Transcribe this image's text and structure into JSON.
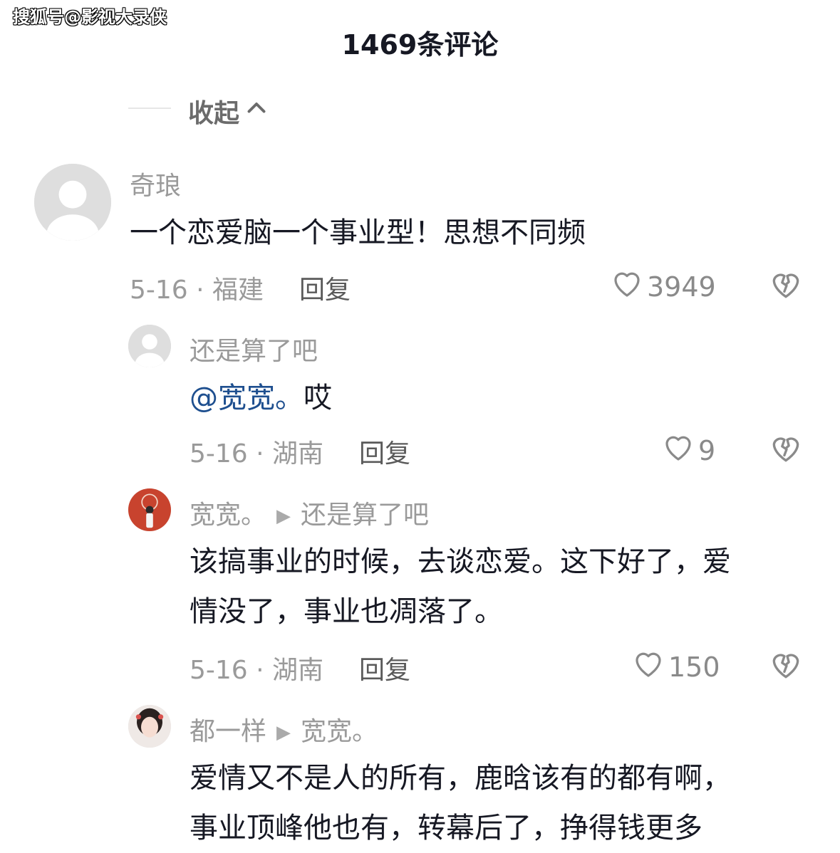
{
  "watermark": "搜狐号@影视大录侠",
  "header": {
    "title": "1469条评论"
  },
  "collapse_label": "收起",
  "comments": [
    {
      "author": "奇琅",
      "text": "一个恋爱脑一个事业型！思想不同频",
      "date_location": "5-16 · 福建",
      "reply_label": "回复",
      "likes": "3949"
    }
  ],
  "replies": [
    {
      "author": "还是算了吧",
      "mention": "@宽宽。",
      "text": "哎",
      "date_location": "5-16 · 湖南",
      "reply_label": "回复",
      "likes": "9"
    },
    {
      "author": "宽宽。",
      "reply_to": "还是算了吧",
      "text_line1": "该搞事业的时候，去谈恋爱。这下好了，爱",
      "text_line2": "情没了，事业也凋落了。",
      "date_location": "5-16 · 湖南",
      "reply_label": "回复",
      "likes": "150"
    },
    {
      "author": "都一样",
      "reply_to": "宽宽。",
      "text_line1": "爱情又不是人的所有，鹿晗该有的都有啊，",
      "text_line2": "事业顶峰他也有，转幕后了，挣得钱更多"
    }
  ],
  "colors": {
    "mention": "#1e4f8f",
    "text": "#161823",
    "muted": "#9a9a9a"
  }
}
